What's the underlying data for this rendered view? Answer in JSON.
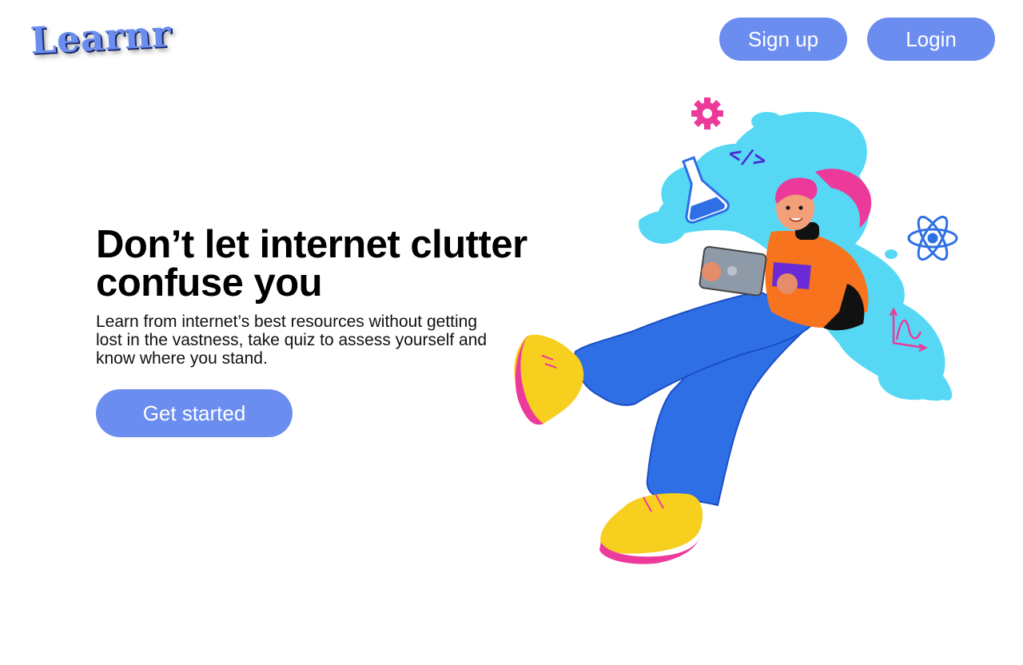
{
  "header": {
    "logo": "Learnr",
    "signup_label": "Sign up",
    "login_label": "Login"
  },
  "hero": {
    "title": "Don’t let internet clutter confuse you",
    "subtitle": "Learn from internet’s best resources without getting lost in the vastness, take quiz to assess yourself and know where you stand.",
    "cta_label": "Get started",
    "code_glyph": "</>"
  },
  "colors": {
    "accent": "#6b8df0",
    "splash": "#56d8f5",
    "hair": "#ec3a9b",
    "shirt": "#f7731e",
    "jeans": "#2f6fe6",
    "shoes": "#f7cf1e"
  },
  "icons": [
    "gear-icon",
    "flask-icon",
    "code-icon",
    "atom-icon",
    "graph-icon",
    "tablet-icon"
  ]
}
